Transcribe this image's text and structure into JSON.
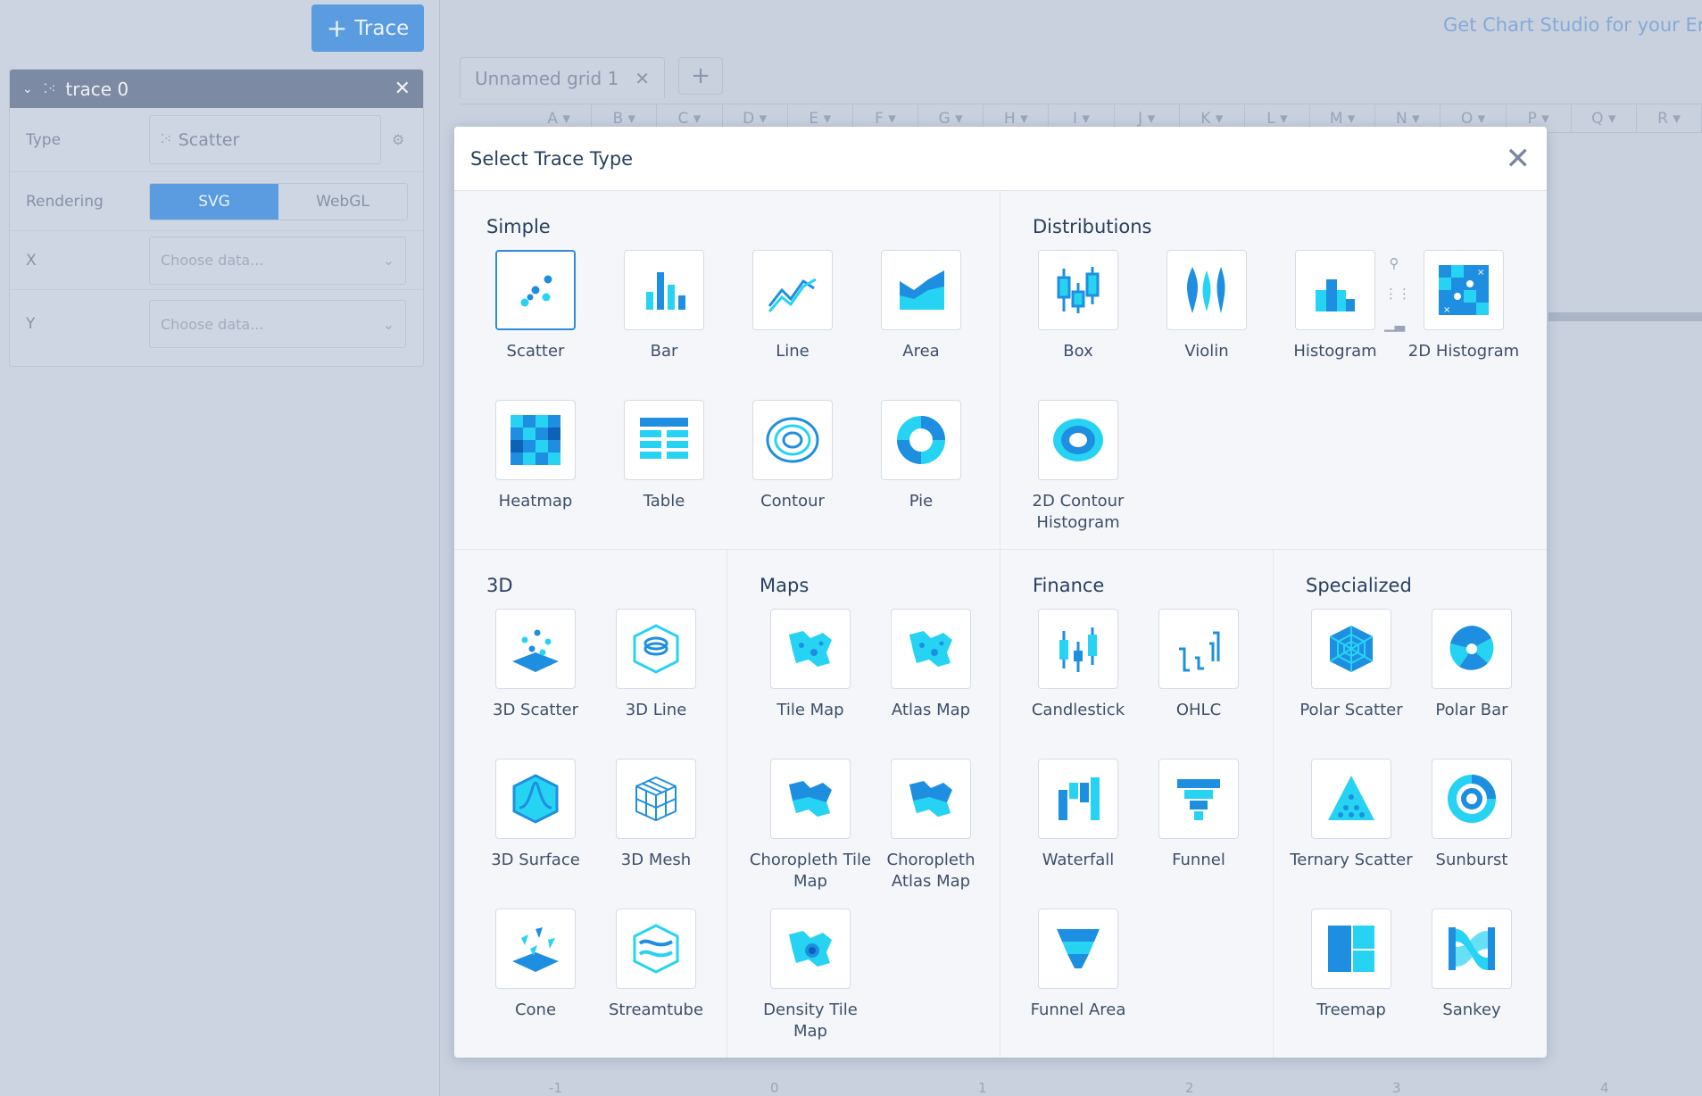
{
  "left": {
    "add_trace": "Trace",
    "trace_name": "trace 0",
    "type_label": "Type",
    "type_value": "Scatter",
    "rendering_label": "Rendering",
    "render_svg": "SVG",
    "render_webgl": "WebGL",
    "x_label": "X",
    "y_label": "Y",
    "x_placeholder": "Choose data...",
    "y_placeholder": "Choose data..."
  },
  "top": {
    "cta": "Get Chart Studio for your Er",
    "grid_tab": "Unnamed grid 1",
    "columns": [
      "A",
      "B",
      "C",
      "D",
      "E",
      "F",
      "G",
      "H",
      "I",
      "J",
      "K",
      "L",
      "M",
      "N",
      "O",
      "P",
      "Q",
      "R"
    ]
  },
  "axis": [
    "-1",
    "0",
    "1",
    "2",
    "3",
    "4"
  ],
  "modal": {
    "title": "Select Trace Type",
    "sections": {
      "simple": {
        "title": "Simple",
        "items": [
          "Scatter",
          "Bar",
          "Line",
          "Area",
          "Heatmap",
          "Table",
          "Contour",
          "Pie"
        ]
      },
      "distributions": {
        "title": "Distributions",
        "items": [
          "Box",
          "Violin",
          "Histogram",
          "2D Histogram",
          "2D Contour Histogram"
        ]
      },
      "three_d": {
        "title": "3D",
        "items": [
          "3D Scatter",
          "3D Line",
          "3D Surface",
          "3D Mesh",
          "Cone",
          "Streamtube"
        ]
      },
      "maps": {
        "title": "Maps",
        "items": [
          "Tile Map",
          "Atlas Map",
          "Choropleth Tile Map",
          "Choropleth Atlas Map",
          "Density Tile Map"
        ]
      },
      "finance": {
        "title": "Finance",
        "items": [
          "Candlestick",
          "OHLC",
          "Waterfall",
          "Funnel",
          "Funnel Area"
        ]
      },
      "specialized": {
        "title": "Specialized",
        "items": [
          "Polar Scatter",
          "Polar Bar",
          "Ternary Scatter",
          "Sunburst",
          "Treemap",
          "Sankey"
        ]
      }
    }
  },
  "colors": {
    "accent": "#2f8bd8",
    "icon_cyan": "#27d3f2",
    "icon_blue": "#1e8fe0"
  }
}
